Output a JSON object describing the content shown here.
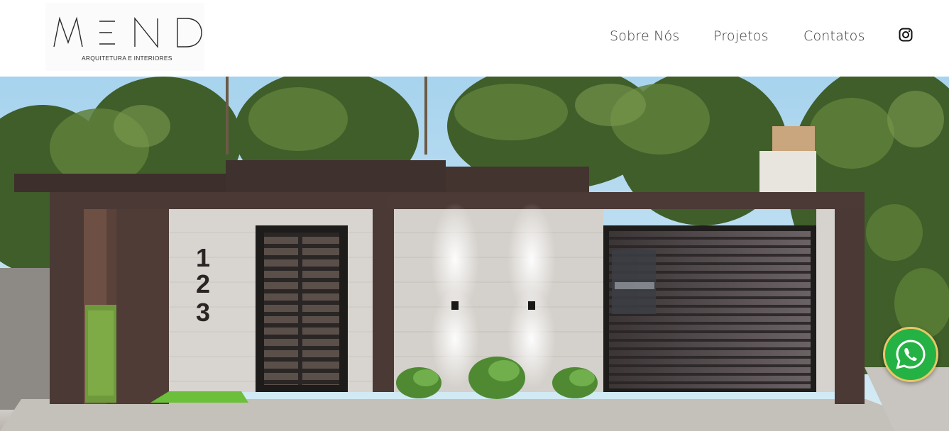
{
  "brand": {
    "name": "MEND",
    "tagline": "ARQUITETURA E INTERIORES"
  },
  "nav": {
    "items": [
      {
        "label": "Sobre Nós"
      },
      {
        "label": "Projetos"
      },
      {
        "label": "Contatos"
      }
    ],
    "social_icon": "instagram-icon"
  },
  "hero": {
    "image": "modern-house-facade",
    "house_number": "123"
  },
  "floating": {
    "icon": "whatsapp-icon",
    "color": "#25b244",
    "border_color": "#e8c867"
  },
  "colors": {
    "wall_brown": "#4a3935",
    "stone": "#d9d6d2",
    "sky": "#b9dcef"
  }
}
